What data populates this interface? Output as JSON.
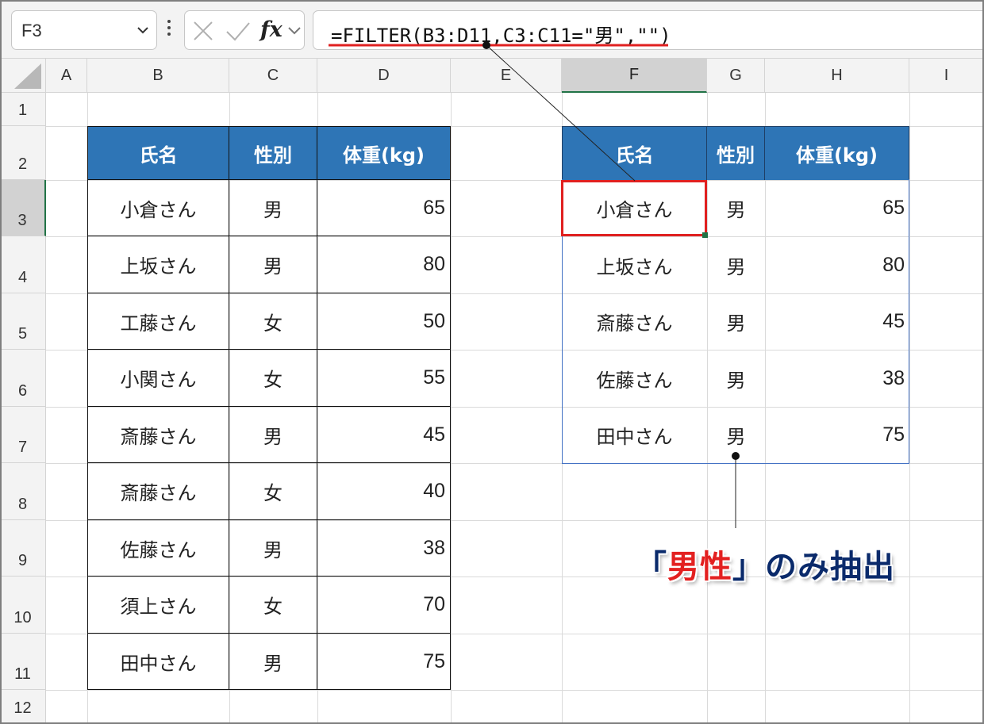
{
  "formula_bar": {
    "name_box": "F3",
    "fx_label": "fx",
    "formula": "=FILTER(B3:D11,C3:C11=\"男\",\"\")"
  },
  "columns": [
    "A",
    "B",
    "C",
    "D",
    "E",
    "F",
    "G",
    "H",
    "I"
  ],
  "selected_column": "F",
  "rows": [
    "1",
    "2",
    "3",
    "4",
    "5",
    "6",
    "7",
    "8",
    "9",
    "10",
    "11",
    "12"
  ],
  "selected_row": "3",
  "source_table": {
    "headers": [
      "氏名",
      "性別",
      "体重(kg)"
    ],
    "rows": [
      [
        "小倉さん",
        "男",
        "65"
      ],
      [
        "上坂さん",
        "男",
        "80"
      ],
      [
        "工藤さん",
        "女",
        "50"
      ],
      [
        "小関さん",
        "女",
        "55"
      ],
      [
        "斎藤さん",
        "男",
        "45"
      ],
      [
        "斎藤さん",
        "女",
        "40"
      ],
      [
        "佐藤さん",
        "男",
        "38"
      ],
      [
        "須上さん",
        "女",
        "70"
      ],
      [
        "田中さん",
        "男",
        "75"
      ]
    ]
  },
  "result_table": {
    "headers": [
      "氏名",
      "性別",
      "体重(kg)"
    ],
    "rows": [
      [
        "小倉さん",
        "男",
        "65"
      ],
      [
        "上坂さん",
        "男",
        "80"
      ],
      [
        "斎藤さん",
        "男",
        "45"
      ],
      [
        "佐藤さん",
        "男",
        "38"
      ],
      [
        "田中さん",
        "男",
        "75"
      ]
    ]
  },
  "callout": {
    "open": "「",
    "emphasis": "男性",
    "close": "」",
    "rest": "のみ抽出"
  },
  "colors": {
    "header_fill": "#2e75b6",
    "highlight_red": "#e02020",
    "callout_navy": "#0a2a6b",
    "excel_green": "#217346"
  }
}
